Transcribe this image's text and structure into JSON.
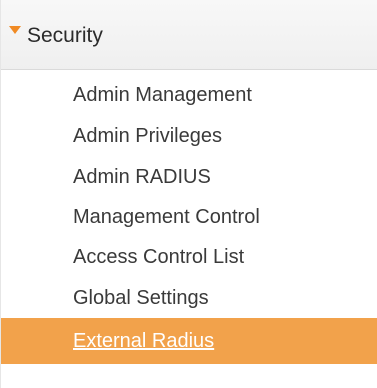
{
  "section": {
    "title": "Security",
    "icon": "caret-down-icon",
    "accent_color": "#f08a24"
  },
  "items": [
    {
      "label": "Admin Management",
      "active": false
    },
    {
      "label": "Admin Privileges",
      "active": false
    },
    {
      "label": "Admin RADIUS",
      "active": false
    },
    {
      "label": "Management Control",
      "active": false
    },
    {
      "label": "Access Control List",
      "active": false
    },
    {
      "label": "Global Settings",
      "active": false
    },
    {
      "label": "External Radius",
      "active": true
    }
  ],
  "colors": {
    "active_background": "#f2a24b",
    "active_text": "#ffffff",
    "text": "#3a3a3a"
  }
}
